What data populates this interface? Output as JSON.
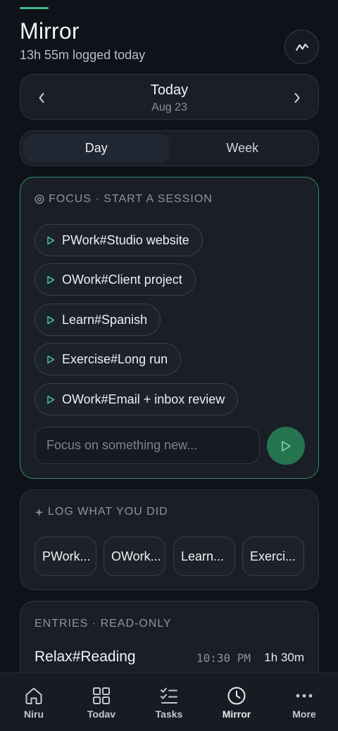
{
  "header": {
    "title": "Mirror",
    "subtitle": "13h 55m logged today",
    "trend_icon": "trend-line-icon"
  },
  "date_nav": {
    "title": "Today",
    "date": "Aug 23",
    "prev_icon": "chevron-left-icon",
    "next_icon": "chevron-right-icon"
  },
  "view_tabs": [
    {
      "label": "Day",
      "active": true
    },
    {
      "label": "Week",
      "active": false
    }
  ],
  "focus": {
    "label": "FOCUS · START A SESSION",
    "label_icon": "target-icon",
    "sessions": [
      "PWork#Studio website",
      "OWork#Client project",
      "Learn#Spanish",
      "Exercise#Long run",
      "OWork#Email + inbox review"
    ],
    "input_placeholder": "Focus on something new...",
    "start_icon": "play-icon"
  },
  "log": {
    "label": "LOG WHAT YOU DID",
    "label_icon": "sparkle-icon",
    "chips": [
      "PWork...",
      "OWork...",
      "Learn...",
      "Exerci..."
    ]
  },
  "entries": {
    "label": "ENTRIES · READ-ONLY",
    "items": [
      {
        "name": "Relax#Reading",
        "time": "10:30 PM",
        "duration": "1h 30m"
      }
    ]
  },
  "bottom_nav": [
    {
      "label": "Niru",
      "icon": "home-icon",
      "active": false
    },
    {
      "label": "Todav",
      "icon": "grid-icon",
      "active": false
    },
    {
      "label": "Tasks",
      "icon": "checklist-icon",
      "active": false
    },
    {
      "label": "Mirror",
      "icon": "clock-icon",
      "active": true
    },
    {
      "label": "More",
      "icon": "more-icon",
      "active": false
    }
  ],
  "colors": {
    "accent": "#3fb98a",
    "start_button": "#24754f",
    "background": "#0f1218",
    "card": "#1a1e26"
  }
}
